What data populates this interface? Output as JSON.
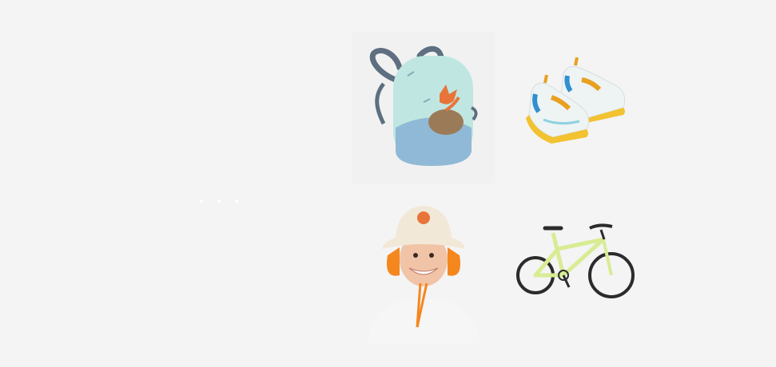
{
  "products": [
    {
      "id": "backpack",
      "icon": "backpack-icon",
      "colors": {
        "body": "#bfe6e0",
        "bottom": "#8fb9d6",
        "straps": "#5d6f80",
        "fox": "#e8743a"
      }
    },
    {
      "id": "shoes",
      "icon": "sneakers-icon",
      "colors": {
        "upper": "#eef3f3",
        "sole": "#f2c230",
        "accent": "#2f8fd1",
        "pull": "#e8a020"
      }
    },
    {
      "id": "hat",
      "icon": "sun-hat-icon",
      "colors": {
        "hat": "#f2e8d8",
        "flap": "#f5871f",
        "shirt": "#f6f6f6",
        "skin": "#f1c4a8"
      }
    },
    {
      "id": "bike",
      "icon": "bicycle-icon",
      "colors": {
        "frame": "#d8ec93",
        "tire": "#2b2b2b"
      }
    }
  ],
  "carousel": {
    "dots": 3,
    "active": 0
  }
}
